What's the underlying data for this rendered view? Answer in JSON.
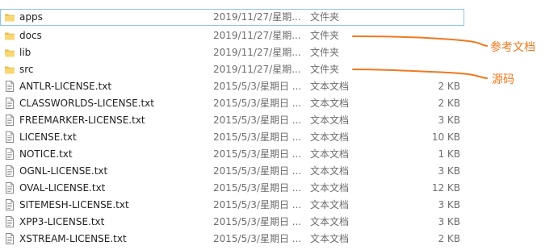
{
  "files": [
    {
      "name": "apps",
      "date": "2019/11/27/星期...",
      "type": "文件夹",
      "size": "",
      "icon": "folder-icon"
    },
    {
      "name": "docs",
      "date": "2019/11/27/星期...",
      "type": "文件夹",
      "size": "",
      "icon": "folder-icon"
    },
    {
      "name": "lib",
      "date": "2019/11/27/星期...",
      "type": "文件夹",
      "size": "",
      "icon": "folder-icon"
    },
    {
      "name": "src",
      "date": "2019/11/27/星期...",
      "type": "文件夹",
      "size": "",
      "icon": "folder-icon"
    },
    {
      "name": "ANTLR-LICENSE.txt",
      "date": "2015/5/3/星期日 ...",
      "type": "文本文档",
      "size": "2 KB",
      "icon": "text-file-icon"
    },
    {
      "name": "CLASSWORLDS-LICENSE.txt",
      "date": "2015/5/3/星期日 ...",
      "type": "文本文档",
      "size": "2 KB",
      "icon": "text-file-icon"
    },
    {
      "name": "FREEMARKER-LICENSE.txt",
      "date": "2015/5/3/星期日 ...",
      "type": "文本文档",
      "size": "3 KB",
      "icon": "text-file-icon"
    },
    {
      "name": "LICENSE.txt",
      "date": "2015/5/3/星期日 ...",
      "type": "文本文档",
      "size": "10 KB",
      "icon": "text-file-icon"
    },
    {
      "name": "NOTICE.txt",
      "date": "2015/5/3/星期日 ...",
      "type": "文本文档",
      "size": "1 KB",
      "icon": "text-file-icon"
    },
    {
      "name": "OGNL-LICENSE.txt",
      "date": "2015/5/3/星期日 ...",
      "type": "文本文档",
      "size": "3 KB",
      "icon": "text-file-icon"
    },
    {
      "name": "OVAL-LICENSE.txt",
      "date": "2015/5/3/星期日 ...",
      "type": "文本文档",
      "size": "12 KB",
      "icon": "text-file-icon"
    },
    {
      "name": "SITEMESH-LICENSE.txt",
      "date": "2015/5/3/星期日 ...",
      "type": "文本文档",
      "size": "3 KB",
      "icon": "text-file-icon"
    },
    {
      "name": "XPP3-LICENSE.txt",
      "date": "2015/5/3/星期日 ...",
      "type": "文本文档",
      "size": "3 KB",
      "icon": "text-file-icon"
    },
    {
      "name": "XSTREAM-LICENSE.txt",
      "date": "2015/5/3/星期日 ...",
      "type": "文本文档",
      "size": "2 KB",
      "icon": "text-file-icon"
    }
  ],
  "selected_file": "apps",
  "annotations": {
    "docs_note": "参考文档",
    "src_note": "源码"
  },
  "colors": {
    "annotation": "#f0781e",
    "selection_border": "#8fc3ec",
    "folder_fill": "#f8d775",
    "folder_tab": "#e8b84a",
    "secondary_text": "#6d6d6d"
  }
}
